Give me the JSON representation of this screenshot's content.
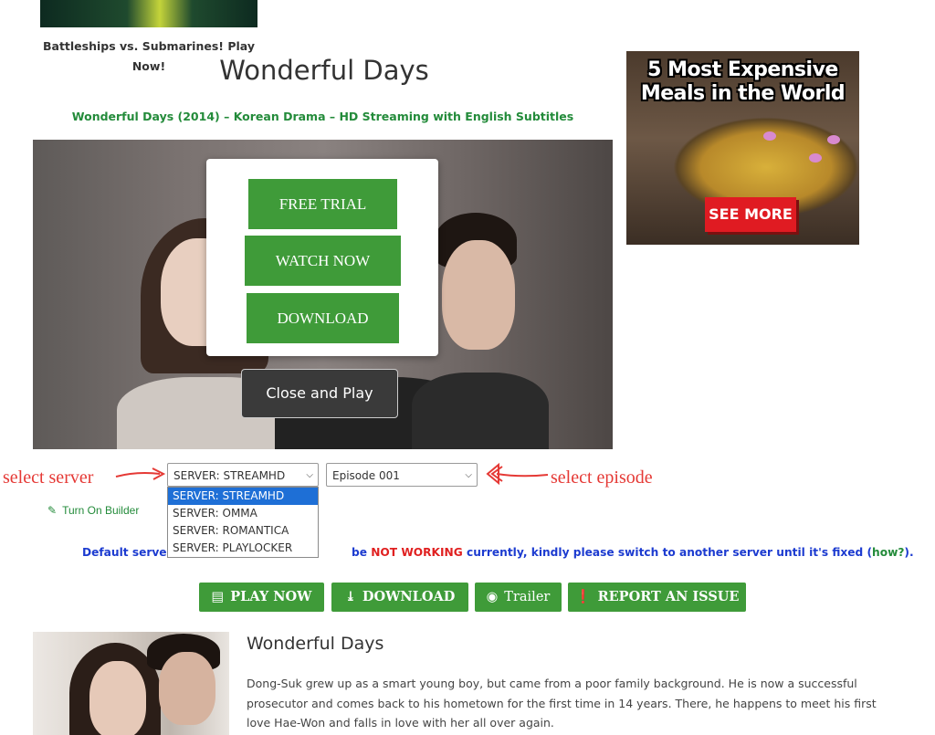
{
  "promo": {
    "caption": "Battleships vs. Submarines! Play Now!"
  },
  "page_title": "Wonderful Days",
  "subtitle": "Wonderful Days (2014) – Korean Drama – HD Streaming with English Subtitles",
  "ad": {
    "title_line1": "5 Most Expensive",
    "title_line2": "Meals in the World",
    "button": "SEE MORE"
  },
  "popup": {
    "free_trial": "FREE TRIAL",
    "watch_now": "WATCH NOW",
    "download": "DOWNLOAD"
  },
  "close_play": "Close and Play",
  "annotations": {
    "select_server": "select server",
    "select_episode": "select episode"
  },
  "server_select": {
    "selected": "SERVER: STREAMHD",
    "options": [
      "SERVER: STREAMHD",
      "SERVER: OMMA",
      "SERVER: ROMANTICA",
      "SERVER: PLAYLOCKER"
    ]
  },
  "episode_select": {
    "selected": "Episode 001"
  },
  "builder_link": "Turn On Builder",
  "notice": {
    "before": "Default serve",
    "middle": "be ",
    "not_working": "NOT WORKING",
    "after": " currently, kindly please switch to another server until it's fixed (",
    "how": "how?",
    "end": ")."
  },
  "actions": {
    "play_now": "PLAY NOW",
    "download": "DOWNLOAD",
    "trailer": "Trailer",
    "report": "REPORT AN ISSUE"
  },
  "drama": {
    "title": "Wonderful Days",
    "synopsis_1": "Dong-Suk grew up as a smart young boy, but came from a poor family background. He is now a successful",
    "synopsis_2": "prosecutor and comes back to his hometown for the first time in 14 years. There, he happens to meet his first",
    "synopsis_3": "love Hae-Won and falls in love with her all over again."
  },
  "colors": {
    "accent_green": "#3f9b39",
    "link_blue": "#1c3bd0",
    "alert_red": "#e02020",
    "highlight_blue": "#1e6fd6"
  }
}
